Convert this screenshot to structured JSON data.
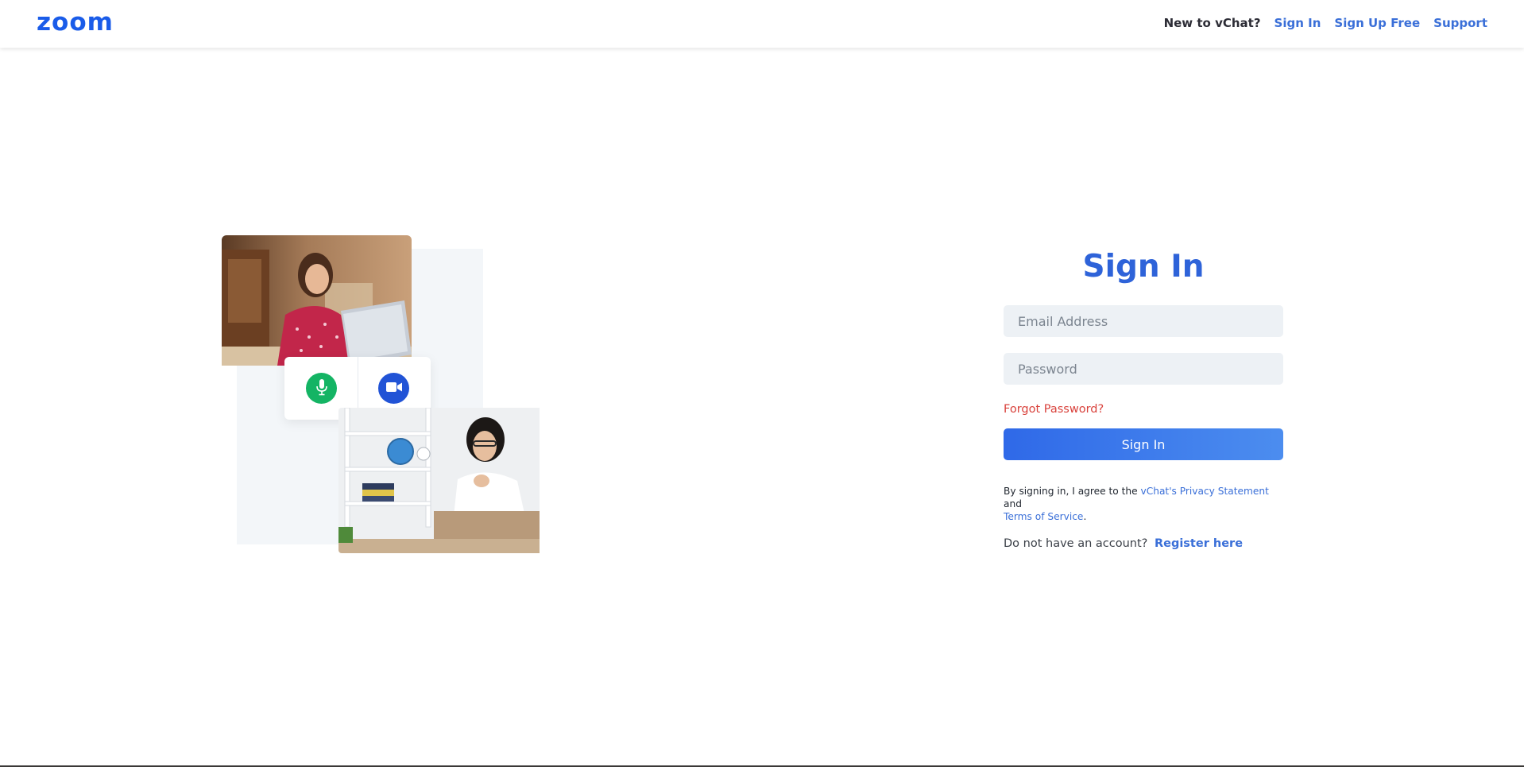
{
  "colors": {
    "brand": "#1a5ce9",
    "link": "#3a6fd8",
    "title": "#2e63d9",
    "danger": "#d9423c",
    "button_start": "#2f69e8",
    "button_end": "#4c8def",
    "mic": "#14b464",
    "camera": "#2153d6"
  },
  "header": {
    "logo_text": "zoom",
    "new_to_label": "New to vChat?",
    "signin_link": "Sign In",
    "signup_link": "Sign Up Free",
    "support_link": "Support"
  },
  "illustration": {
    "mic_icon": "microphone-icon",
    "camera_icon": "video-camera-icon"
  },
  "signin": {
    "title": "Sign In",
    "email_placeholder": "Email Address",
    "password_placeholder": "Password",
    "forgot_password": "Forgot Password?",
    "submit_label": "Sign In",
    "terms_prefix": "By signing in, I agree to the ",
    "privacy_link": "vChat's Privacy Statement",
    "terms_and": " and",
    "terms_link": "Terms of Service",
    "terms_suffix": ".",
    "no_account_text": "Do not have an account?",
    "register_link": "Register here"
  }
}
